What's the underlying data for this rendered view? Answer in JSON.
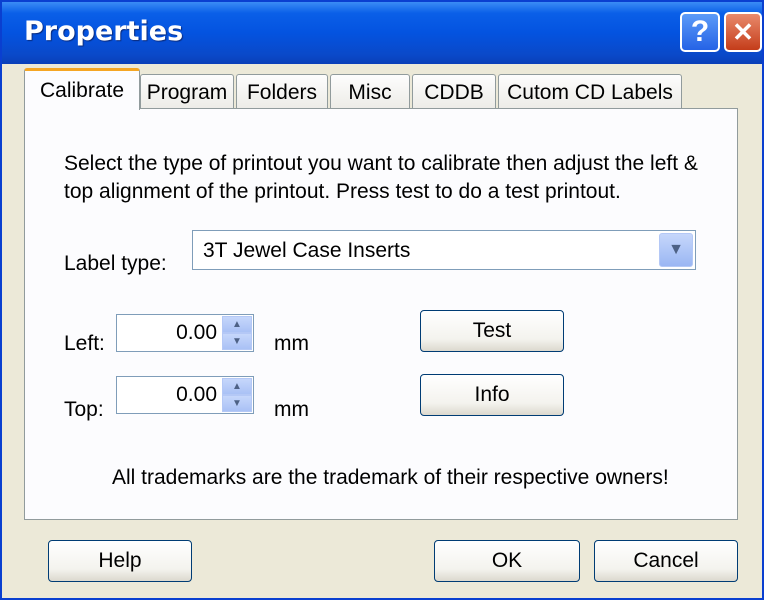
{
  "window": {
    "title": "Properties",
    "help_glyph": "?",
    "close_glyph": "✕"
  },
  "tabs": [
    {
      "label": "Calibrate"
    },
    {
      "label": "Program"
    },
    {
      "label": "Folders"
    },
    {
      "label": "Misc"
    },
    {
      "label": "CDDB"
    },
    {
      "label": "Cutom CD Labels"
    }
  ],
  "active_tab": "Calibrate",
  "calibrate": {
    "description": "Select the type of printout you want to calibrate then adjust the left & top alignment of the printout. Press test to do a test printout.",
    "label_type_label": "Label type:",
    "label_type_value": "3T Jewel Case Inserts",
    "left_label": "Left:",
    "left_value": "0.00",
    "left_unit": "mm",
    "top_label": "Top:",
    "top_value": "0.00",
    "top_unit": "mm",
    "test_button": "Test",
    "info_button": "Info",
    "trademark_text": "All trademarks are the trademark of their respective owners!"
  },
  "footer": {
    "help_button": "Help",
    "ok_button": "OK",
    "cancel_button": "Cancel"
  },
  "colors": {
    "titlebar": "#0453e0",
    "window_face": "#ece9d8",
    "active_tab_accent": "#f5a623",
    "button_border": "#003c74"
  }
}
